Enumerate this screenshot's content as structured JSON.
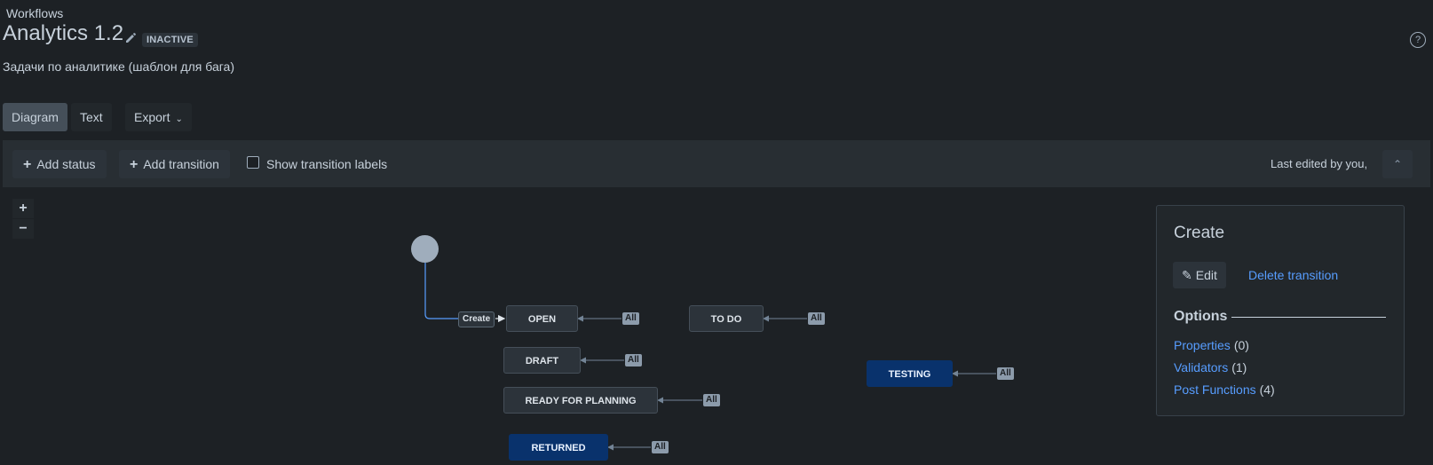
{
  "header": {
    "breadcrumb": "Workflows",
    "title": "Analytics 1.2",
    "badge": "INACTIVE",
    "description": "Задачи по аналитике (шаблон для бага)",
    "help": "?"
  },
  "tabs": {
    "diagram": "Diagram",
    "text": "Text",
    "export": "Export"
  },
  "toolbar": {
    "add_status": "Add status",
    "add_transition": "Add transition",
    "show_labels": "Show transition labels",
    "last_edited": "Last edited by you,"
  },
  "zoom": {
    "in": "+",
    "out": "−"
  },
  "diagram": {
    "create_label": "Create",
    "all_tag": "All",
    "statuses": {
      "open": "OPEN",
      "todo": "TO DO",
      "draft": "DRAFT",
      "ready": "READY FOR PLANNING",
      "returned": "RETURNED",
      "testing": "TESTING"
    },
    "colors": {
      "default_status": "#2c333a",
      "done_status": "#09326c",
      "start_node": "#9fadbc",
      "selected_transition": "#579dff"
    }
  },
  "sidepanel": {
    "title": "Create",
    "edit": "Edit",
    "delete": "Delete transition",
    "options_heading": "Options",
    "options": [
      {
        "label": "Properties",
        "count": "(0)"
      },
      {
        "label": "Validators",
        "count": "(1)"
      },
      {
        "label": "Post Functions",
        "count": "(4)"
      }
    ]
  }
}
